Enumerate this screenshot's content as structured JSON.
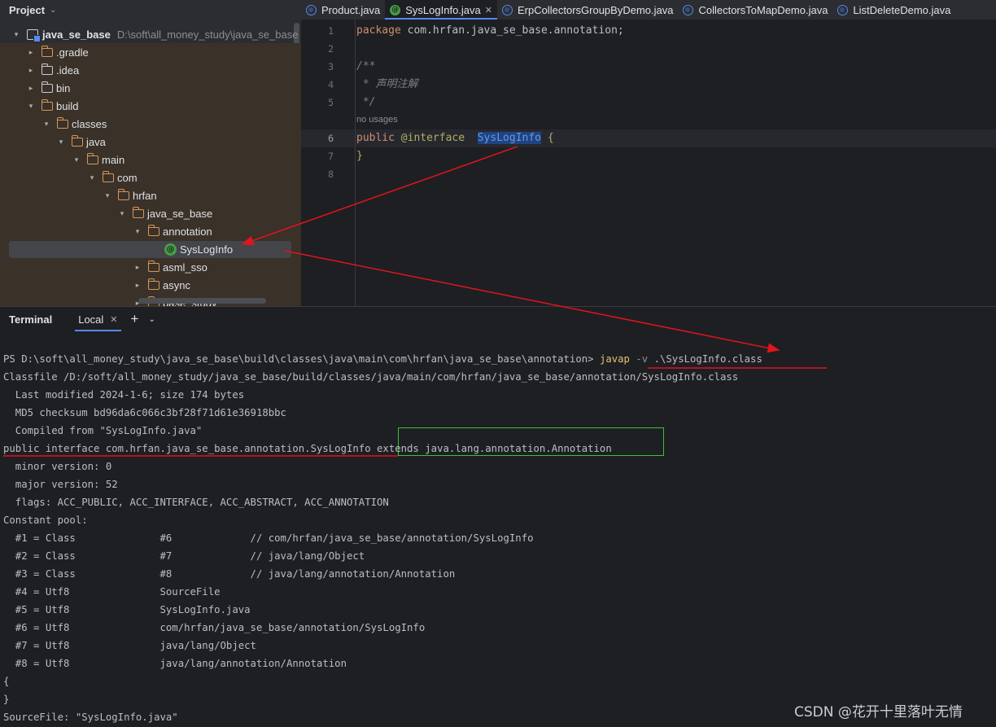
{
  "project": {
    "title": "Project",
    "tree": [
      {
        "label": "java_se_base",
        "hint": "D:\\soft\\all_money_study\\java_se_base",
        "bold": true
      },
      {
        "label": ".gradle"
      },
      {
        "label": ".idea"
      },
      {
        "label": "bin"
      },
      {
        "label": "build"
      },
      {
        "label": "classes"
      },
      {
        "label": "java"
      },
      {
        "label": "main"
      },
      {
        "label": "com"
      },
      {
        "label": "hrfan"
      },
      {
        "label": "java_se_base"
      },
      {
        "label": "annotation"
      },
      {
        "label": "SysLogInfo"
      },
      {
        "label": "asml_sso"
      },
      {
        "label": "async"
      },
      {
        "label": "base_study"
      }
    ]
  },
  "tabs": [
    {
      "label": "Product.java",
      "icon": "class-icon"
    },
    {
      "label": "SysLogInfo.java",
      "icon": "annotation-icon",
      "active": true
    },
    {
      "label": "ErpCollectorsGroupByDemo.java",
      "icon": "class-icon"
    },
    {
      "label": "CollectorsToMapDemo.java",
      "icon": "class-icon"
    },
    {
      "label": "ListDeleteDemo.java",
      "icon": "class-icon"
    }
  ],
  "editor": {
    "line_numbers": [
      "1",
      "2",
      "3",
      "4",
      "5",
      "6",
      "7",
      "8"
    ],
    "package_kw": "package",
    "package_name": " com.hrfan.java_se_base.annotation;",
    "comment_open": "/**",
    "comment_body": " * 声明注解",
    "comment_close": " */",
    "usages_hint": "no usages",
    "public_kw": "public",
    "interface_kw": "@interface",
    "class_name": "SysLogInfo",
    "open_brace": " {",
    "close_brace": "}"
  },
  "terminal": {
    "title": "Terminal",
    "tab_label": "Local",
    "prompt": "PS D:\\soft\\all_money_study\\java_se_base\\build\\classes\\java\\main\\com\\hrfan\\java_se_base\\annotation> ",
    "cmd": "javap",
    "opt": " -v ",
    "arg": ".\\SysLogInfo.class",
    "lines": [
      "Classfile /D:/soft/all_money_study/java_se_base/build/classes/java/main/com/hrfan/java_se_base/annotation/SysLogInfo.class",
      "  Last modified 2024-1-6; size 174 bytes",
      "  MD5 checksum bd96da6c066c3bf28f71d61e36918bbc",
      "  Compiled from \"SysLogInfo.java\"",
      "public interface com.hrfan.java_se_base.annotation.SysLogInfo extends java.lang.annotation.Annotation",
      "  minor version: 0",
      "  major version: 52",
      "  flags: ACC_PUBLIC, ACC_INTERFACE, ACC_ABSTRACT, ACC_ANNOTATION",
      "Constant pool:",
      "  #1 = Class              #6             // com/hrfan/java_se_base/annotation/SysLogInfo",
      "  #2 = Class              #7             // java/lang/Object",
      "  #3 = Class              #8             // java/lang/annotation/Annotation",
      "  #4 = Utf8               SourceFile",
      "  #5 = Utf8               SysLogInfo.java",
      "  #6 = Utf8               com/hrfan/java_se_base/annotation/SysLogInfo",
      "  #7 = Utf8               java/lang/Object",
      "  #8 = Utf8               java/lang/annotation/Annotation",
      "{",
      "}",
      "SourceFile: \"SysLogInfo.java\""
    ]
  },
  "watermark": "CSDN @花开十里落叶无情",
  "colors": {
    "arrow": "#e0141e",
    "green_box": "#3cc13c",
    "accent": "#548af7"
  }
}
